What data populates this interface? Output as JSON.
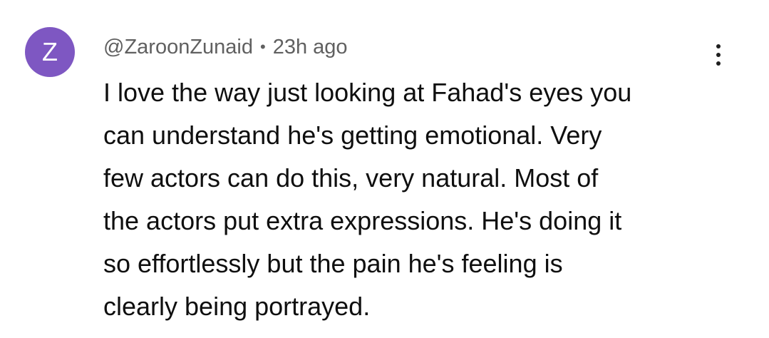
{
  "comment": {
    "avatar_letter": "Z",
    "avatar_color": "#7e57c2",
    "author": "@ZaroonZunaid",
    "separator": "•",
    "time": "23h ago",
    "more_icon": "more-vertical-icon",
    "lines": [
      "I love the way just looking at Fahad's eyes you",
      "can understand he's getting emotional. Very",
      "few actors can do this, very natural. Most of",
      "the actors put extra expressions. He's doing it",
      "so effortlessly but the pain he's feeling is",
      "clearly being portrayed."
    ]
  }
}
